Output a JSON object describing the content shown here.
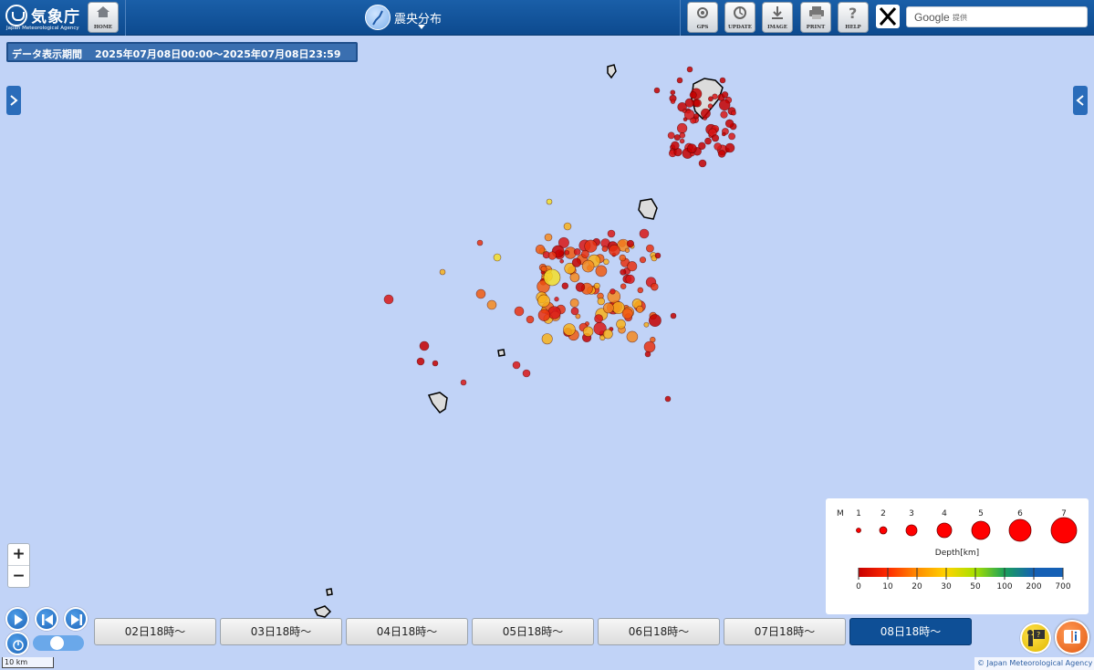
{
  "header": {
    "logo_text": "気象庁",
    "logo_sub": "Japan Meteorological Agency",
    "home_label": "HOME",
    "title": "震央分布",
    "tools": {
      "gps": "GPS",
      "update": "UPDATE",
      "image": "IMAGE",
      "print": "PRINT",
      "help": "HELP"
    },
    "search_brand": "Google",
    "search_suffix": "提供"
  },
  "period": {
    "label": "データ表示期間",
    "range": "2025年07月08日00:00〜2025年07月08日23:59"
  },
  "zoom": {
    "in": "+",
    "out": "−"
  },
  "timeline": {
    "buttons": [
      "02日18時〜",
      "03日18時〜",
      "04日18時〜",
      "05日18時〜",
      "06日18時〜",
      "07日18時〜",
      "08日18時〜"
    ],
    "active_index": 6
  },
  "scale_label": "10 km",
  "attribution": "© Japan Meteorological Agency",
  "legend": {
    "m_label": "M",
    "magnitudes": [
      "1",
      "2",
      "3",
      "4",
      "5",
      "6",
      "7"
    ],
    "depth_label": "Depth[km]",
    "depth_ticks": [
      "0",
      "10",
      "20",
      "30",
      "50",
      "100",
      "200",
      "700"
    ],
    "depth_colors": [
      "#c80000",
      "#ff2a00",
      "#ff8c00",
      "#ffd400",
      "#a6e000",
      "#1aa05a",
      "#1560b5"
    ]
  },
  "colors": {
    "sea": "#c1d3f7",
    "header": "#1a5fa8",
    "active_button": "#0e4f96"
  }
}
